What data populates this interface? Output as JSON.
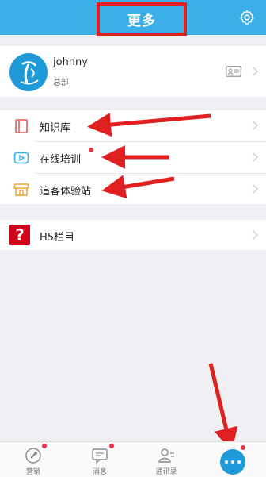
{
  "header": {
    "title": "更多",
    "settings_icon": "gear-icon"
  },
  "profile": {
    "name": "johnny",
    "subtitle": "总部",
    "card_icon": "id-card-icon"
  },
  "menu": {
    "items": [
      {
        "label": "知识库",
        "icon": "book-icon",
        "color": "#e05c5c"
      },
      {
        "label": "在线培训",
        "icon": "video-icon",
        "color": "#3aaee6",
        "badge": true
      },
      {
        "label": "追客体验站",
        "icon": "store-icon",
        "color": "#f0a22f"
      }
    ]
  },
  "h5": {
    "label": "H5栏目",
    "icon_glyph": "?"
  },
  "tabbar": {
    "items": [
      {
        "label": "营销",
        "icon": "microphone-icon",
        "badge": true
      },
      {
        "label": "消息",
        "icon": "message-icon",
        "badge": true
      },
      {
        "label": "通讯录",
        "icon": "contacts-icon",
        "badge": false
      }
    ],
    "more_icon": "more-dots-icon",
    "more_badge": true
  },
  "colors": {
    "header": "#3aaee6",
    "highlight": "#e02020",
    "accent": "#1e9ad8"
  }
}
